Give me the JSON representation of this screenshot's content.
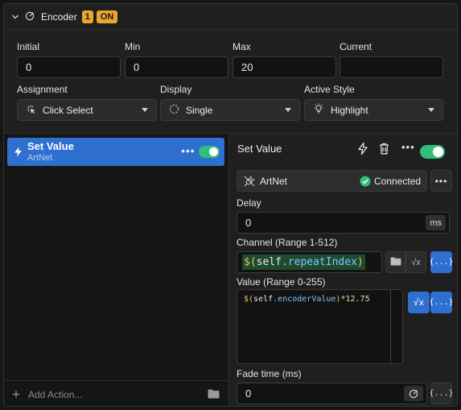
{
  "header": {
    "title": "Encoder",
    "badge_number": "1",
    "badge_state": "ON"
  },
  "fields": {
    "initial": {
      "label": "Initial",
      "value": "0"
    },
    "min": {
      "label": "Min",
      "value": "0"
    },
    "max": {
      "label": "Max",
      "value": "20"
    },
    "current": {
      "label": "Current",
      "value": ""
    }
  },
  "selects": {
    "assignment": {
      "label": "Assignment",
      "value": "Click Select"
    },
    "display": {
      "label": "Display",
      "value": "Single"
    },
    "active_style": {
      "label": "Active Style",
      "value": "Highlight"
    }
  },
  "actions": {
    "items": [
      {
        "name": "Set Value",
        "sub": "ArtNet",
        "dots": "•••",
        "enabled": true
      }
    ],
    "add_label": "Add Action..."
  },
  "detail": {
    "title": "Set Value",
    "dots": "•••",
    "connection": {
      "label": "ArtNet",
      "status": "Connected",
      "dots": "•••"
    },
    "delay": {
      "label": "Delay",
      "value": "0",
      "unit": "ms"
    },
    "channel": {
      "label": "Channel (Range 1-512)",
      "expr_prefix": "$(",
      "expr_self": "self",
      "expr_dot": ".",
      "expr_prop": "repeatIndex",
      "expr_suffix": ")"
    },
    "value": {
      "label": "Value (Range 0-255)",
      "expr_prefix": "$(",
      "expr_self": "self",
      "expr_dot": ".",
      "expr_prop": "encoderValue",
      "expr_suffix": ")",
      "expr_op": "*",
      "expr_num": "12.75"
    },
    "fade": {
      "label": "Fade time (ms)",
      "value": "0"
    },
    "var_button": "{...}",
    "sqrt_symbol": "√x"
  },
  "colors": {
    "accent_blue": "#2f6fd0",
    "badge": "#e8a530",
    "toggle_on": "#2fc07a",
    "connected": "#2fc07a"
  }
}
